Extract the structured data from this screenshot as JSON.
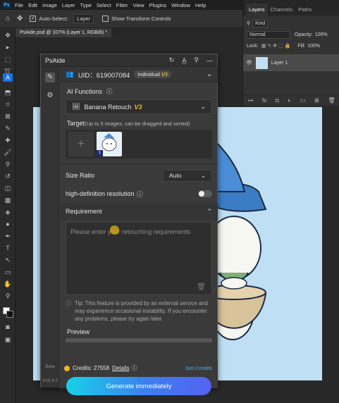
{
  "menubar": {
    "logo": "Ps",
    "items": [
      "File",
      "Edit",
      "Image",
      "Layer",
      "Type",
      "Select",
      "Filter",
      "View",
      "Plugins",
      "Window",
      "Help"
    ]
  },
  "options_bar": {
    "auto_select_label": "Auto-Select:",
    "auto_select_value": "Layer",
    "transform_controls_label": "Show Transform Controls"
  },
  "document_tab": {
    "label": "PsAide.psd @ 107% (Layer 1, RGB/8) *"
  },
  "layers_panel": {
    "tabs": [
      "Layers",
      "Channels",
      "Paths"
    ],
    "kind_label": "Kind",
    "blend_mode": "Normal",
    "opacity_label": "Opacity:",
    "opacity_value": "100%",
    "lock_label": "Lock:",
    "fill_label": "Fill:",
    "fill_value": "100%",
    "layer_name": "Layer 1",
    "footer_icons": [
      "link-icon",
      "fx-icon",
      "mask-icon",
      "adjustment-icon",
      "group-icon",
      "new-layer-icon",
      "trash-icon"
    ]
  },
  "psaide": {
    "title": "PsAide",
    "uid_label": "UID：619007084",
    "tier": "Individual",
    "tier_badge": "V3",
    "ai_functions_label": "AI Functions",
    "function_value": "Banana Retouch",
    "function_badge": "V3",
    "target_label": "Target",
    "target_hint": "(Up to 5 images, can be dragged and sorted)",
    "target_image_index": "1",
    "size_ratio_label": "Size Ratio",
    "size_ratio_value": "Auto",
    "hd_label": "high-definition resolution",
    "hd_enabled": false,
    "requirement_label": "Requirement",
    "requirement_placeholder": "Please enter your retouching requirements",
    "tip": "Tip: This feature is provided by an external service and may experience occasional instability. If you encounter any problems, please try again later.",
    "preview_label": "Preview",
    "credits_label": "Credits: 27558",
    "details_label": "Details",
    "get_credits_label": "Get Credits",
    "generate_label": "Generate immediately",
    "beta_label": "Beta",
    "version_label": "V25.4.0"
  },
  "colors": {
    "accent": "#1473e6",
    "canvas_bg": "#bfe0f4",
    "gold": "#f0b429",
    "link": "#3fb0ff"
  }
}
